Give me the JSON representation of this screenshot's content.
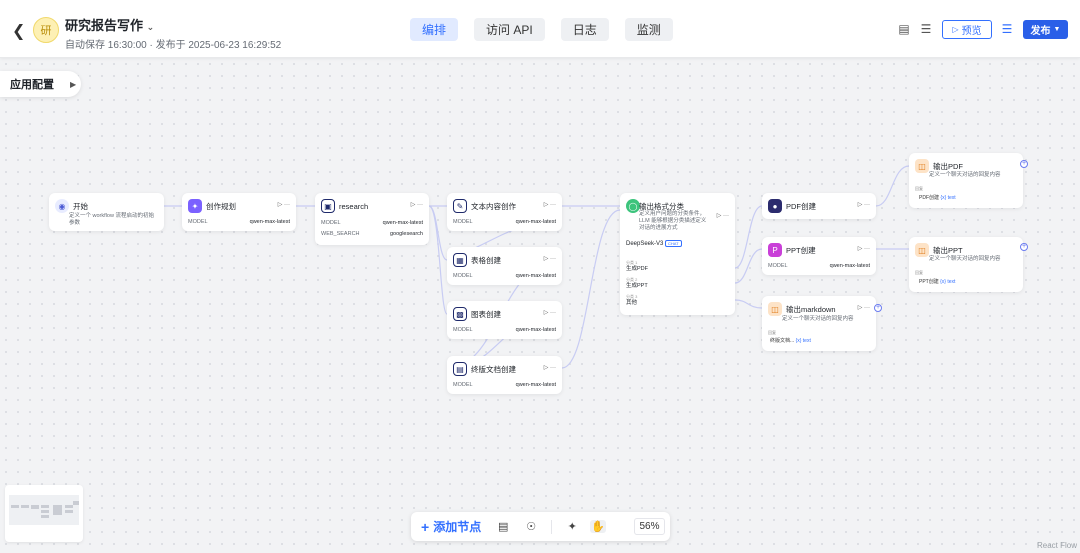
{
  "header": {
    "avatar_text": "研",
    "title": "研究报告写作",
    "subtitle": "自动保存 16:30:00 · 发布于 2025-06-23 16:29:52",
    "tabs": [
      "编排",
      "访问 API",
      "日志",
      "监测"
    ],
    "preview_label": "预览",
    "publish_label": "发布"
  },
  "config_label": "应用配置",
  "nodes": {
    "start": {
      "title": "开始",
      "desc": "定义一个 workflow 流程启动的初始参数"
    },
    "plan": {
      "title": "创作规划",
      "model_key": "MODEL",
      "model": "qwen-max-latest"
    },
    "research": {
      "title": "research",
      "model_key": "MODEL",
      "model": "qwen-max-latest",
      "search_key": "WEB_SEARCH",
      "search": "googlesearch"
    },
    "text": {
      "title": "文本内容创作",
      "model_key": "MODEL",
      "model": "qwen-max-latest"
    },
    "table": {
      "title": "表格创建",
      "model_key": "MODEL",
      "model": "qwen-max-latest"
    },
    "chart": {
      "title": "图表创建",
      "model_key": "MODEL",
      "model": "qwen-max-latest"
    },
    "final": {
      "title": "终版文档创建",
      "model_key": "MODEL",
      "model": "qwen-max-latest"
    },
    "classify": {
      "title": "输出格式分类",
      "desc": "定义用户问题的分类条件，LLM 能够根据分类描述定义对话的进展方式",
      "model": "DeepSeek-V3",
      "model_tag": "CHAT",
      "cats": [
        {
          "label": "分类 1",
          "value": "生成PDF"
        },
        {
          "label": "分类 2",
          "value": "生成PPT"
        },
        {
          "label": "分类 3",
          "value": "其他"
        }
      ]
    },
    "pdf": {
      "title": "PDF创建"
    },
    "ppt": {
      "title": "PPT创建",
      "model_key": "MODEL",
      "model": "qwen-max-latest"
    },
    "md": {
      "title": "输出markdown",
      "desc": "定义一个聊天对话的回复内容",
      "out_label": "回复",
      "out_var": "终版文档...",
      "out_type": "{x} text"
    },
    "out_pdf": {
      "title": "输出PDF",
      "desc": "定义一个聊天对话的回复内容",
      "out_label": "回复",
      "out_var": "PDF创建",
      "out_type": "{x} text"
    },
    "out_ppt": {
      "title": "输出PPT",
      "desc": "定义一个聊天对话的回复内容",
      "out_label": "回复",
      "out_var": "PPT创建",
      "out_type": "{x} text"
    }
  },
  "toolbar": {
    "add_node": "添加节点",
    "zoom": "56%"
  },
  "footer": "React Flow",
  "colors": {
    "accent": "#3370ff",
    "publish": "#2a5fe8",
    "edge": "#c4c9f5"
  }
}
